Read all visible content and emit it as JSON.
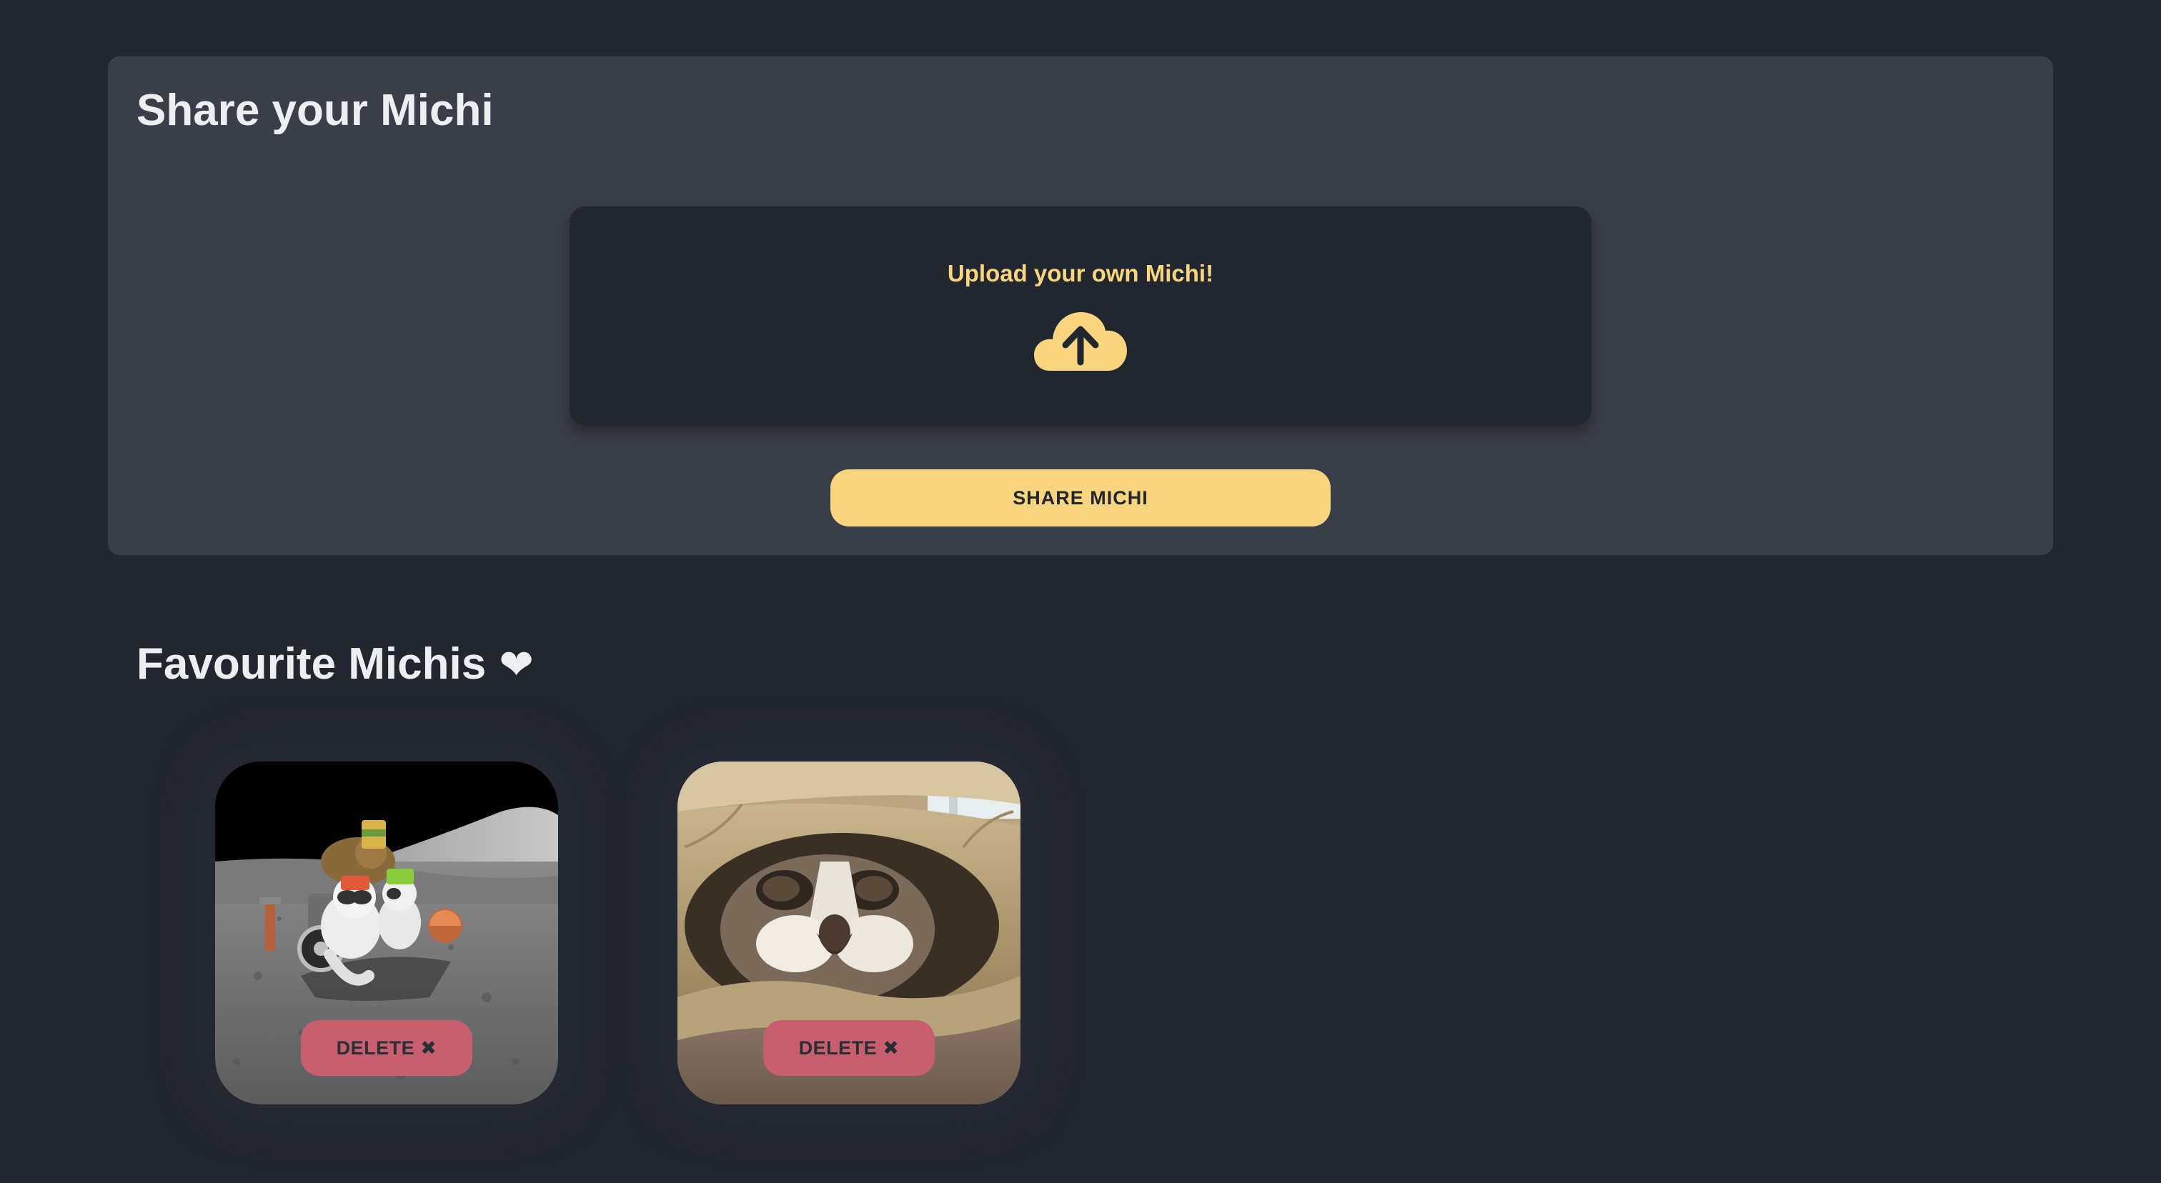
{
  "share": {
    "title": "Share your Michi",
    "upload_label": "Upload your own Michi!",
    "upload_icon": "cloud-upload-icon",
    "button_label": "SHARE MICHI"
  },
  "favourites": {
    "title": "Favourite Michis",
    "title_icon": "heart-icon",
    "heart_glyph": "❤",
    "items": [
      {
        "image": "cats-on-moon-rover-photo",
        "delete_label": "DELETE",
        "delete_icon_glyph": "✖"
      },
      {
        "image": "cat-in-paper-bag-photo",
        "delete_label": "DELETE",
        "delete_icon_glyph": "✖"
      }
    ]
  },
  "colors": {
    "background": "#22262f",
    "panel": "#3a3e48",
    "accent_yellow": "#f8d57e",
    "delete_red": "#c85f6e",
    "heading_text": "#eceef2"
  }
}
